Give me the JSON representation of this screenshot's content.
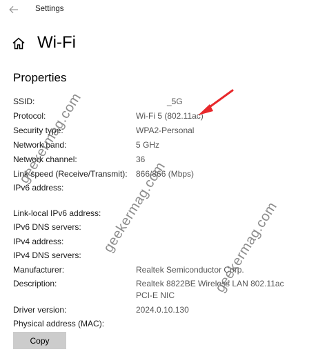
{
  "app": {
    "title": "Settings"
  },
  "header": {
    "title": "Wi-Fi"
  },
  "section": {
    "title": "Properties"
  },
  "properties": [
    {
      "label": "SSID:",
      "value": "_5G"
    },
    {
      "label": "Protocol:",
      "value": "Wi-Fi 5 (802.11ac)"
    },
    {
      "label": "Security type:",
      "value": "WPA2-Personal"
    },
    {
      "label": "Network band:",
      "value": "5 GHz"
    },
    {
      "label": "Network channel:",
      "value": "36"
    },
    {
      "label": "Link speed (Receive/Transmit):",
      "value": "866/866 (Mbps)"
    },
    {
      "label": "IPv6 address:",
      "value": ""
    },
    {
      "label": "Link-local IPv6 address:",
      "value": ""
    },
    {
      "label": "IPv6 DNS servers:",
      "value": ""
    },
    {
      "label": "IPv4 address:",
      "value": ""
    },
    {
      "label": "IPv4 DNS servers:",
      "value": ""
    },
    {
      "label": "Manufacturer:",
      "value": "Realtek Semiconductor Corp."
    },
    {
      "label": "Description:",
      "value": "Realtek 8822BE Wireless LAN 802.11ac",
      "value2": "PCI-E NIC"
    },
    {
      "label": "Driver version:",
      "value": "2024.0.10.130"
    },
    {
      "label": "Physical address (MAC):",
      "value": ""
    }
  ],
  "actions": {
    "copy_label": "Copy"
  },
  "watermarks": [
    "geekermag.com",
    "geekermag.com",
    "geekermag.com"
  ],
  "icons": {
    "back": "arrow-left-icon",
    "home": "home-icon",
    "annotation": "red-arrow-icon"
  },
  "colors": {
    "copy_button_bg": "#cccccc",
    "annotation_arrow": "#e8282b",
    "value_text": "#555555"
  }
}
